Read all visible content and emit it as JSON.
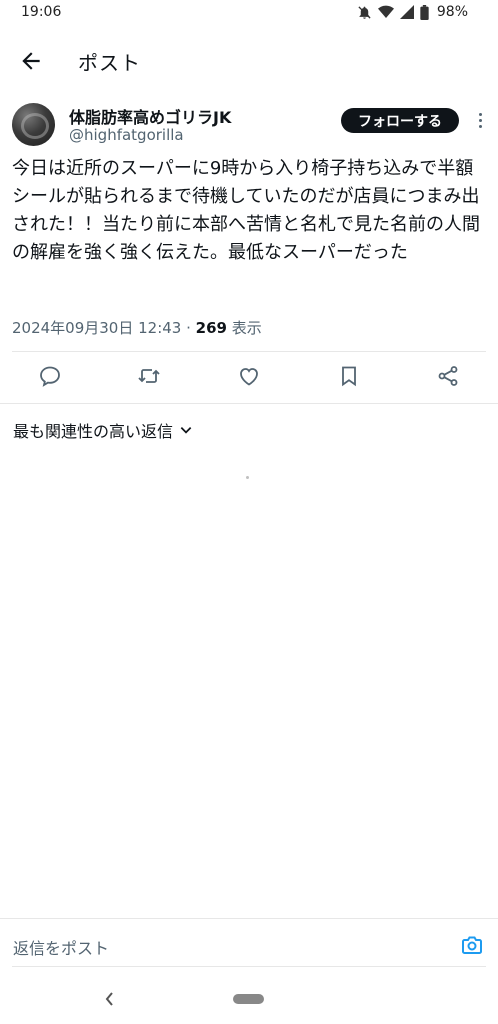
{
  "status_bar": {
    "time": "19:06",
    "battery": "98%",
    "icons": [
      "bell-off-icon",
      "wifi-icon",
      "signal-icon",
      "battery-icon"
    ]
  },
  "header": {
    "title": "ポスト",
    "back_icon": "back-arrow-icon"
  },
  "author": {
    "display_name": "体脂肪率高めゴリラJK",
    "handle": "@highfatgorilla",
    "follow_label": "フォローする"
  },
  "post": {
    "text": "今日は近所のスーパーに9時から入り椅子持ち込みで半額シールが貼られるまで待機していたのだが店員につまみ出された！！当たり前に本部へ苦情と名札で見た名前の人間の解雇を強く強く伝えた。最低なスーパーだった",
    "datetime": "2024年09月30日 12:43",
    "separator": " · ",
    "views_count": "269",
    "views_label": " 表示"
  },
  "actions": [
    "reply-icon",
    "repost-icon",
    "like-icon",
    "bookmark-icon",
    "share-icon"
  ],
  "replies": {
    "sort_label": "最も関連性の高い返信"
  },
  "composer": {
    "placeholder": "返信をポスト"
  },
  "colors": {
    "text": "#0f1419",
    "secondary": "#536471",
    "accent": "#1d9bf0",
    "divider": "#e7e7e7"
  }
}
